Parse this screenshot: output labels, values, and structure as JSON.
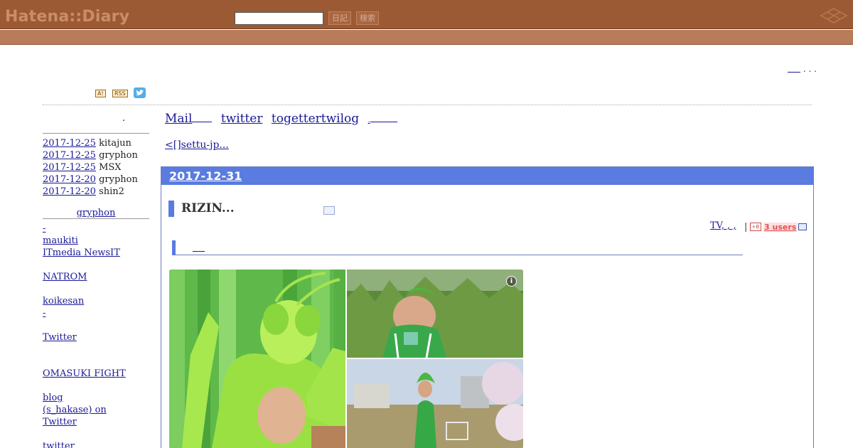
{
  "header": {
    "logo": "Hatena::Diary",
    "search_value": "",
    "diary_button": "日記",
    "search_button": "検索"
  },
  "top_right": {
    "trailing": ". . ."
  },
  "badges": {
    "a_label": "A!",
    "rss_label": "RSS"
  },
  "sidebar": {
    "dot": ".",
    "recent": [
      {
        "date": "2017-12-25",
        "user": "kitajun"
      },
      {
        "date": "2017-12-25",
        "user": "gryphon"
      },
      {
        "date": "2017-12-25",
        "user": "MSX"
      },
      {
        "date": "2017-12-20",
        "user": "gryphon"
      },
      {
        "date": "2017-12-20",
        "user": "shin2"
      }
    ],
    "owner_link": "gryphon",
    "links": [
      "-",
      "maukiti",
      "ITmedia NewsIT",
      "",
      "NATROM",
      "",
      "koikesan",
      "-",
      "",
      "Twitter",
      "",
      "",
      "OMASUKI FIGHT",
      "",
      "blog",
      "(s_hakase) on",
      "Twitter",
      "",
      "twitter"
    ]
  },
  "main": {
    "nav": [
      "Mail",
      "twitter",
      "togettertwilog",
      "."
    ],
    "prev_link": "<[]settu-jp..."
  },
  "day": {
    "date": "2017-12-31",
    "entry": {
      "title": "RIZIN...",
      "meta": "TV, , ,",
      "separator": "|",
      "hatebu_label": "+B",
      "users": "3 users"
    },
    "photo_info": "i"
  },
  "colors": {
    "header_bg": "#9c5a34",
    "subbar_bg": "#b87c5b",
    "day_header_bg": "#5a7be0",
    "link": "#1a1a99"
  }
}
